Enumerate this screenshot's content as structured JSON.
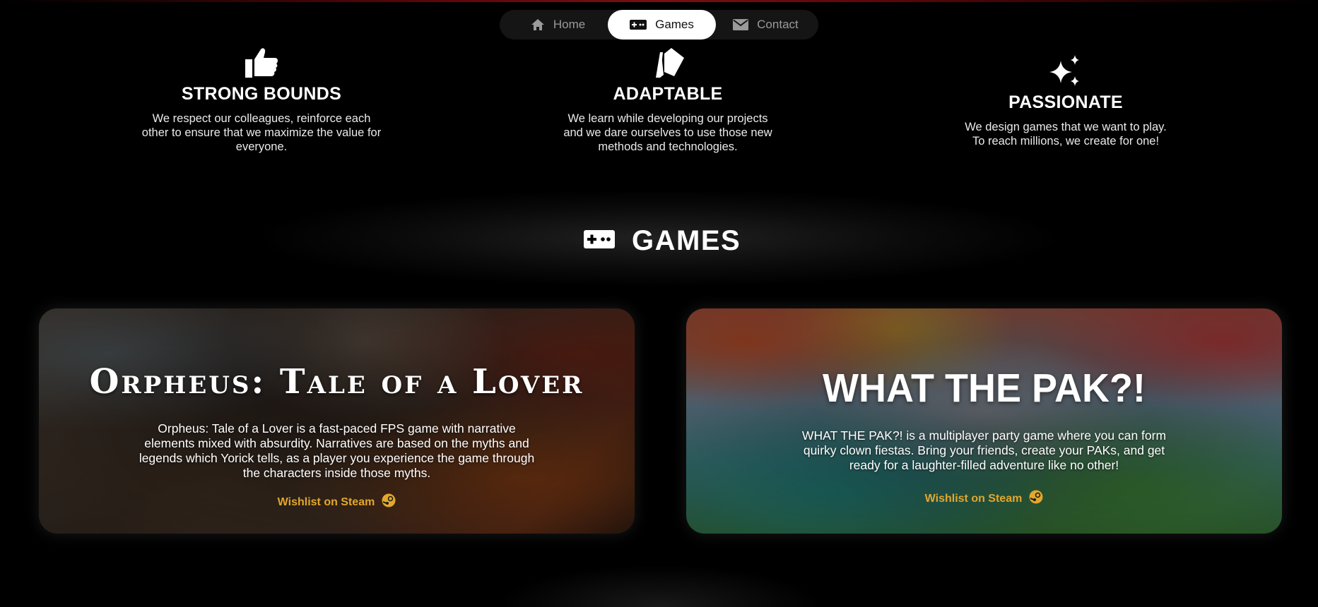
{
  "nav": {
    "items": [
      {
        "label": "Home",
        "icon": "home-icon"
      },
      {
        "label": "Games",
        "icon": "gamepad-icon",
        "active": true
      },
      {
        "label": "Contact",
        "icon": "mail-icon"
      }
    ]
  },
  "values": [
    {
      "icon": "thumbs-up-icon",
      "title": "STRONG BOUNDS",
      "text": "We respect our colleagues, reinforce each other to ensure that we maximize the value for everyone."
    },
    {
      "icon": "cards-icon",
      "title": "ADAPTABLE",
      "text": "We learn while developing our projects and we dare ourselves to use those new methods and technologies."
    },
    {
      "icon": "sparkles-icon",
      "title": "PASSIONATE",
      "text": "We design games that we want to play. To reach millions, we create for one!"
    }
  ],
  "games_section": {
    "heading": "GAMES",
    "icon": "gamepad-icon"
  },
  "games": [
    {
      "title": "Orpheus: Tale of a Lover",
      "description": "Orpheus: Tale of a Lover is a fast-paced FPS game with narrative elements mixed with absurdity. Narratives are based on the myths and legends which Yorick tells, as a player you experience the game through the characters inside those myths.",
      "link_label": "Wishlist on Steam",
      "link_icon": "steam-icon"
    },
    {
      "title": "WHAT THE PAK?!",
      "description": "WHAT THE PAK?! is a multiplayer party game where you can form quirky clown fiestas. Bring your friends, create your PAKs, and get ready for a laughter-filled adventure like no other!",
      "link_label": "Wishlist on Steam",
      "link_icon": "steam-icon"
    }
  ],
  "colors": {
    "background": "#000000",
    "nav_bg": "#151515",
    "nav_active_bg": "#ffffff",
    "link": "#e2a72d"
  }
}
